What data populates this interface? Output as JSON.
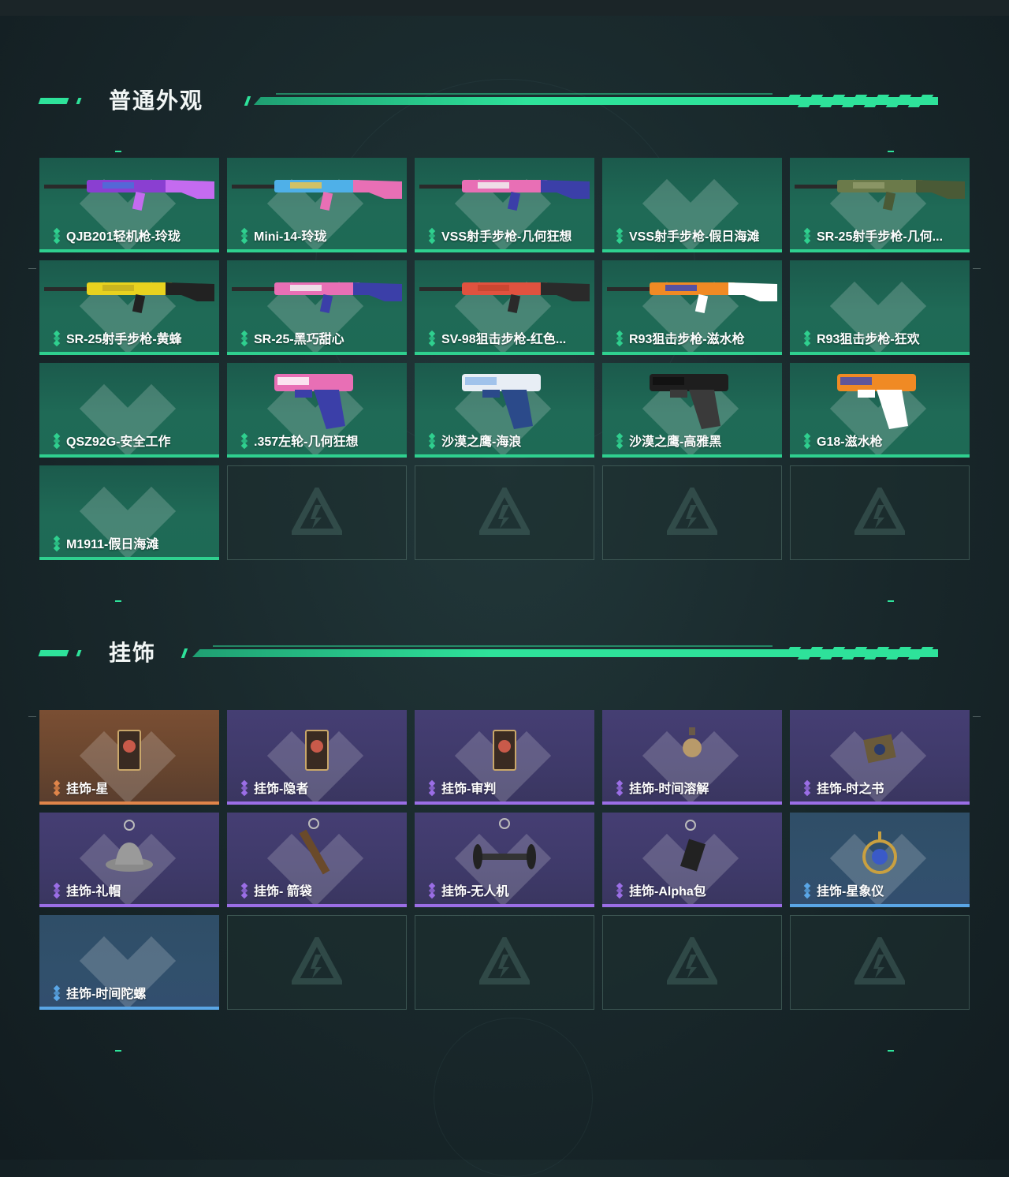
{
  "sections": {
    "skins": {
      "title": "普通外观",
      "items": [
        {
          "name": "QJB201轻机枪-玲珑",
          "rarity": "green",
          "icon": "rifle-purple-icon"
        },
        {
          "name": "Mini-14-玲珑",
          "rarity": "green",
          "icon": "rifle-rainbow-icon"
        },
        {
          "name": "VSS射手步枪-几何狂想",
          "rarity": "green",
          "icon": "rifle-pink-icon"
        },
        {
          "name": "VSS射手步枪-假日海滩",
          "rarity": "green",
          "icon": ""
        },
        {
          "name": "SR-25射手步枪-几何...",
          "rarity": "green",
          "icon": "rifle-camo-icon"
        },
        {
          "name": "SR-25射手步枪-黄蜂",
          "rarity": "green",
          "icon": "rifle-yellow-icon"
        },
        {
          "name": "SR-25-黑巧甜心",
          "rarity": "green",
          "icon": "rifle-pink-icon"
        },
        {
          "name": "SV-98狙击步枪-红色...",
          "rarity": "green",
          "icon": "sniper-red-icon"
        },
        {
          "name": "R93狙击步枪-滋水枪",
          "rarity": "green",
          "icon": "sniper-orange-icon"
        },
        {
          "name": "R93狙击步枪-狂欢",
          "rarity": "green",
          "icon": ""
        },
        {
          "name": "QSZ92G-安全工作",
          "rarity": "green",
          "icon": ""
        },
        {
          "name": ".357左轮-几何狂想",
          "rarity": "green",
          "icon": "revolver-icon"
        },
        {
          "name": "沙漠之鹰-海浪",
          "rarity": "green",
          "icon": "pistol-blue-icon"
        },
        {
          "name": "沙漠之鹰-高雅黑",
          "rarity": "green",
          "icon": "pistol-black-icon"
        },
        {
          "name": "G18-滋水枪",
          "rarity": "green",
          "icon": "pistol-orange-icon"
        },
        {
          "name": "M1911-假日海滩",
          "rarity": "green",
          "icon": ""
        }
      ],
      "empty_slots": 4
    },
    "charms": {
      "title": "挂饰",
      "items": [
        {
          "name": "挂饰-星",
          "rarity": "orange",
          "icon": "charm-card-icon"
        },
        {
          "name": "挂饰-隐者",
          "rarity": "purple",
          "icon": "charm-card-icon"
        },
        {
          "name": "挂饰-审判",
          "rarity": "purple",
          "icon": "charm-card-icon"
        },
        {
          "name": "挂饰-时间溶解",
          "rarity": "purple",
          "icon": "charm-skull-icon"
        },
        {
          "name": "挂饰-时之书",
          "rarity": "purple",
          "icon": "charm-book-icon"
        },
        {
          "name": "挂饰-礼帽",
          "rarity": "purple",
          "icon": "charm-hat-icon"
        },
        {
          "name": "挂饰- 箭袋",
          "rarity": "purple",
          "icon": "charm-quiver-icon"
        },
        {
          "name": "挂饰-无人机",
          "rarity": "purple",
          "icon": "charm-drone-icon"
        },
        {
          "name": "挂饰-Alpha包",
          "rarity": "purple",
          "icon": "charm-pouch-icon"
        },
        {
          "name": "挂饰-星象仪",
          "rarity": "blue",
          "icon": "charm-astrolabe-icon"
        },
        {
          "name": "挂饰-时间陀螺",
          "rarity": "blue",
          "icon": ""
        }
      ],
      "empty_slots": 4
    }
  },
  "colors": {
    "accent": "#2ee29a",
    "green": "#2fd08f",
    "orange": "#e0854a",
    "purple": "#9b6ee6",
    "blue": "#5aa6e6"
  }
}
